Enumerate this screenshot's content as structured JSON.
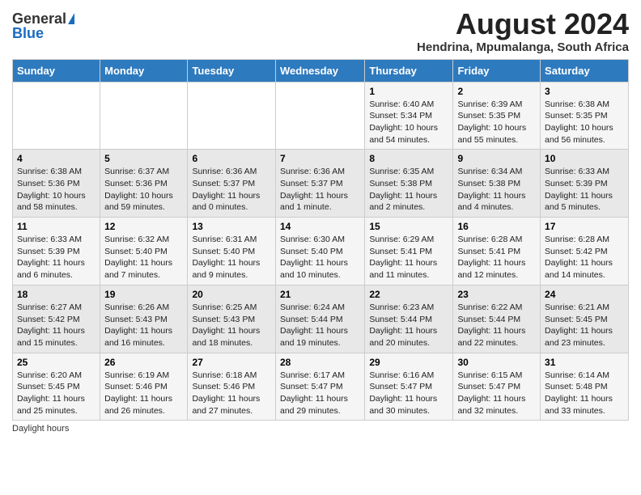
{
  "header": {
    "logo_general": "General",
    "logo_blue": "Blue",
    "title": "August 2024",
    "subtitle": "Hendrina, Mpumalanga, South Africa"
  },
  "weekdays": [
    "Sunday",
    "Monday",
    "Tuesday",
    "Wednesday",
    "Thursday",
    "Friday",
    "Saturday"
  ],
  "footer": {
    "daylight_label": "Daylight hours"
  },
  "weeks": [
    [
      {
        "day": "",
        "info": ""
      },
      {
        "day": "",
        "info": ""
      },
      {
        "day": "",
        "info": ""
      },
      {
        "day": "",
        "info": ""
      },
      {
        "day": "1",
        "info": "Sunrise: 6:40 AM\nSunset: 5:34 PM\nDaylight: 10 hours and 54 minutes."
      },
      {
        "day": "2",
        "info": "Sunrise: 6:39 AM\nSunset: 5:35 PM\nDaylight: 10 hours and 55 minutes."
      },
      {
        "day": "3",
        "info": "Sunrise: 6:38 AM\nSunset: 5:35 PM\nDaylight: 10 hours and 56 minutes."
      }
    ],
    [
      {
        "day": "4",
        "info": "Sunrise: 6:38 AM\nSunset: 5:36 PM\nDaylight: 10 hours and 58 minutes."
      },
      {
        "day": "5",
        "info": "Sunrise: 6:37 AM\nSunset: 5:36 PM\nDaylight: 10 hours and 59 minutes."
      },
      {
        "day": "6",
        "info": "Sunrise: 6:36 AM\nSunset: 5:37 PM\nDaylight: 11 hours and 0 minutes."
      },
      {
        "day": "7",
        "info": "Sunrise: 6:36 AM\nSunset: 5:37 PM\nDaylight: 11 hours and 1 minute."
      },
      {
        "day": "8",
        "info": "Sunrise: 6:35 AM\nSunset: 5:38 PM\nDaylight: 11 hours and 2 minutes."
      },
      {
        "day": "9",
        "info": "Sunrise: 6:34 AM\nSunset: 5:38 PM\nDaylight: 11 hours and 4 minutes."
      },
      {
        "day": "10",
        "info": "Sunrise: 6:33 AM\nSunset: 5:39 PM\nDaylight: 11 hours and 5 minutes."
      }
    ],
    [
      {
        "day": "11",
        "info": "Sunrise: 6:33 AM\nSunset: 5:39 PM\nDaylight: 11 hours and 6 minutes."
      },
      {
        "day": "12",
        "info": "Sunrise: 6:32 AM\nSunset: 5:40 PM\nDaylight: 11 hours and 7 minutes."
      },
      {
        "day": "13",
        "info": "Sunrise: 6:31 AM\nSunset: 5:40 PM\nDaylight: 11 hours and 9 minutes."
      },
      {
        "day": "14",
        "info": "Sunrise: 6:30 AM\nSunset: 5:40 PM\nDaylight: 11 hours and 10 minutes."
      },
      {
        "day": "15",
        "info": "Sunrise: 6:29 AM\nSunset: 5:41 PM\nDaylight: 11 hours and 11 minutes."
      },
      {
        "day": "16",
        "info": "Sunrise: 6:28 AM\nSunset: 5:41 PM\nDaylight: 11 hours and 12 minutes."
      },
      {
        "day": "17",
        "info": "Sunrise: 6:28 AM\nSunset: 5:42 PM\nDaylight: 11 hours and 14 minutes."
      }
    ],
    [
      {
        "day": "18",
        "info": "Sunrise: 6:27 AM\nSunset: 5:42 PM\nDaylight: 11 hours and 15 minutes."
      },
      {
        "day": "19",
        "info": "Sunrise: 6:26 AM\nSunset: 5:43 PM\nDaylight: 11 hours and 16 minutes."
      },
      {
        "day": "20",
        "info": "Sunrise: 6:25 AM\nSunset: 5:43 PM\nDaylight: 11 hours and 18 minutes."
      },
      {
        "day": "21",
        "info": "Sunrise: 6:24 AM\nSunset: 5:44 PM\nDaylight: 11 hours and 19 minutes."
      },
      {
        "day": "22",
        "info": "Sunrise: 6:23 AM\nSunset: 5:44 PM\nDaylight: 11 hours and 20 minutes."
      },
      {
        "day": "23",
        "info": "Sunrise: 6:22 AM\nSunset: 5:44 PM\nDaylight: 11 hours and 22 minutes."
      },
      {
        "day": "24",
        "info": "Sunrise: 6:21 AM\nSunset: 5:45 PM\nDaylight: 11 hours and 23 minutes."
      }
    ],
    [
      {
        "day": "25",
        "info": "Sunrise: 6:20 AM\nSunset: 5:45 PM\nDaylight: 11 hours and 25 minutes."
      },
      {
        "day": "26",
        "info": "Sunrise: 6:19 AM\nSunset: 5:46 PM\nDaylight: 11 hours and 26 minutes."
      },
      {
        "day": "27",
        "info": "Sunrise: 6:18 AM\nSunset: 5:46 PM\nDaylight: 11 hours and 27 minutes."
      },
      {
        "day": "28",
        "info": "Sunrise: 6:17 AM\nSunset: 5:47 PM\nDaylight: 11 hours and 29 minutes."
      },
      {
        "day": "29",
        "info": "Sunrise: 6:16 AM\nSunset: 5:47 PM\nDaylight: 11 hours and 30 minutes."
      },
      {
        "day": "30",
        "info": "Sunrise: 6:15 AM\nSunset: 5:47 PM\nDaylight: 11 hours and 32 minutes."
      },
      {
        "day": "31",
        "info": "Sunrise: 6:14 AM\nSunset: 5:48 PM\nDaylight: 11 hours and 33 minutes."
      }
    ]
  ]
}
